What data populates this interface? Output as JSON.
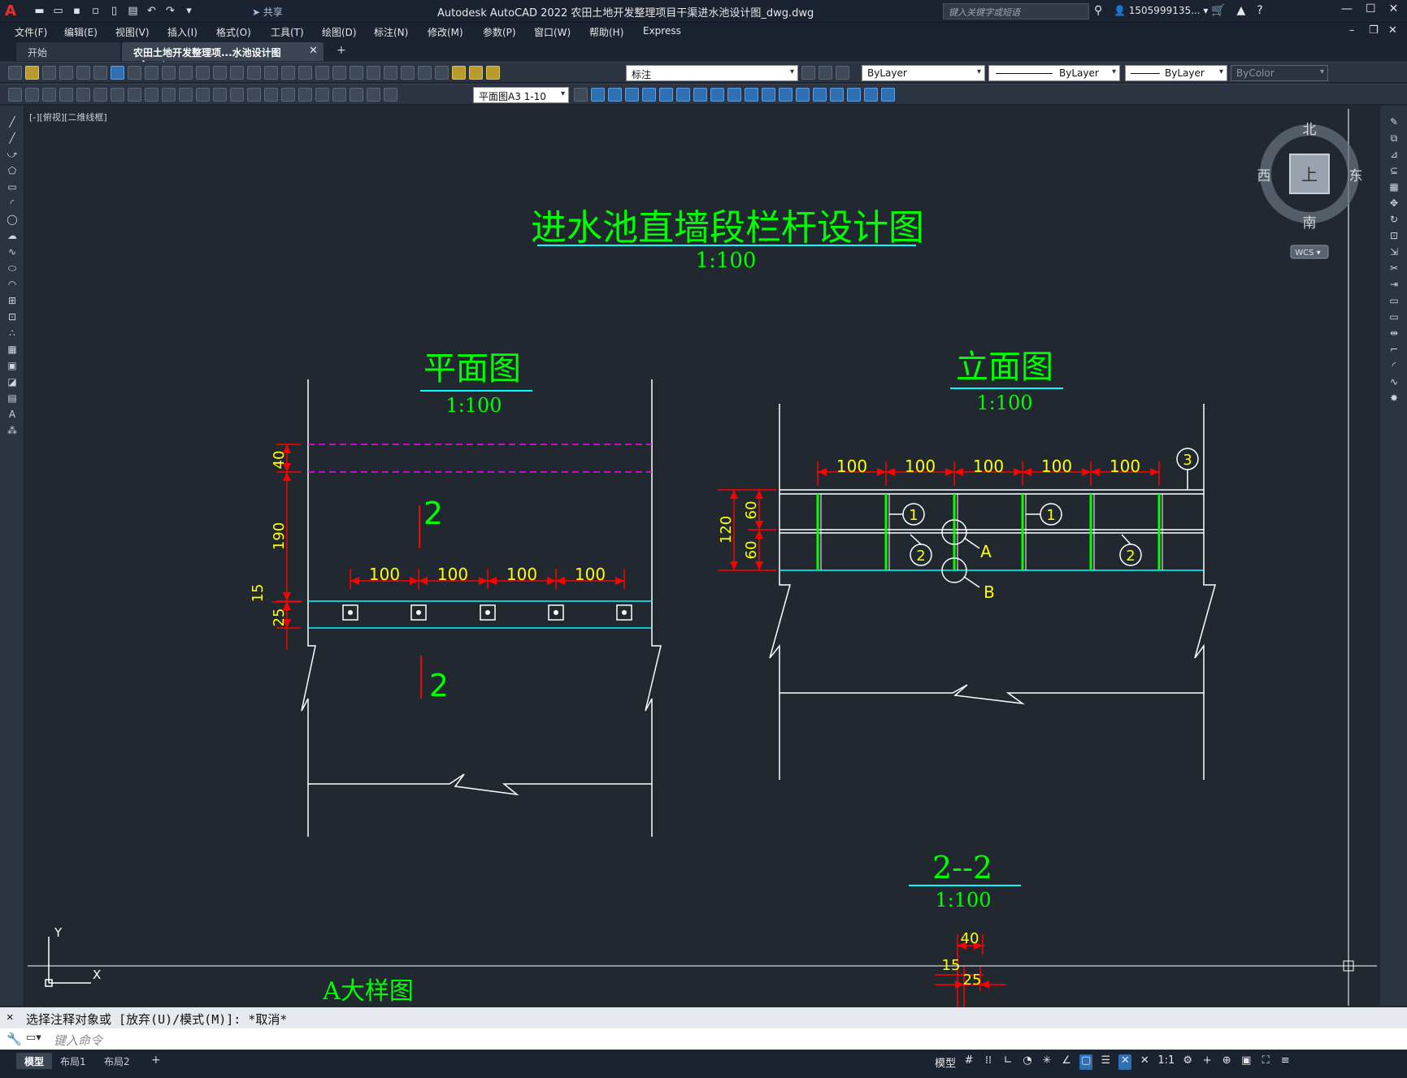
{
  "app": {
    "title": "Autodesk AutoCAD 2022    农田土地开发整理项目干渠进水池设计图_dwg.dwg",
    "logo": "A",
    "share": "共享",
    "search_placeholder": "键入关键字或短语",
    "user": "1505999135... ▾"
  },
  "menu": [
    "文件(F)",
    "编辑(E)",
    "视图(V)",
    "插入(I)",
    "格式(O)",
    "工具(T)",
    "绘图(D)",
    "标注(N)",
    "修改(M)",
    "参数(P)",
    "窗口(W)",
    "帮助(H)",
    "Express"
  ],
  "tabs": {
    "start": "开始",
    "doc": "农田土地开发整理项...水池设计图_dwg*",
    "close": "✕",
    "add": "+"
  },
  "toolbar": {
    "layer": "标注",
    "color": "ByLayer",
    "linetype": "ByLayer",
    "lineweight": "ByLayer",
    "plotstyle": "ByColor",
    "dimstyle": "平面图A3 1-10"
  },
  "viewport": {
    "label": "[-][俯视][二维线框]"
  },
  "viewcube": {
    "north": "北",
    "south": "南",
    "east": "东",
    "west": "西",
    "top": "上",
    "wcs": "WCS ▾"
  },
  "ucs": {
    "y": "Y",
    "x": "X"
  },
  "drawing": {
    "main_title": "进水池直墙段栏杆设计图",
    "main_scale": "1:100",
    "plan_title": "平面图",
    "plan_scale": "1:100",
    "elev_title": "立面图",
    "elev_scale": "1:100",
    "section_title": "2--2",
    "section_scale": "1:100",
    "detail_title": "A大样图",
    "section_mark": "2",
    "plan_dims": {
      "d40": "40",
      "d190": "190",
      "d15": "15",
      "d25": "25",
      "d100": "100"
    },
    "elev_dims": {
      "d100": "100",
      "d120": "120",
      "d60": "60"
    },
    "section_dims": {
      "d40": "40",
      "d15": "15",
      "d25": "25"
    },
    "callouts": {
      "c1": "1",
      "c2": "2",
      "c3": "3",
      "A": "A",
      "B": "B"
    }
  },
  "command": {
    "history": "选择注释对象或 [放弃(U)/模式(M)]: *取消*",
    "placeholder": "键入命令",
    "close": "✕"
  },
  "status": {
    "model": "模型",
    "layout1": "布局1",
    "layout2": "布局2",
    "add": "+",
    "model_btn": "模型",
    "scale": "1:1"
  },
  "colors": {
    "background": "#212830",
    "green": "#00ff00",
    "red": "#ff0000",
    "yellow": "#ffff00",
    "cyan": "#00ffff",
    "magenta": "#ff00ff",
    "white": "#ffffff"
  }
}
